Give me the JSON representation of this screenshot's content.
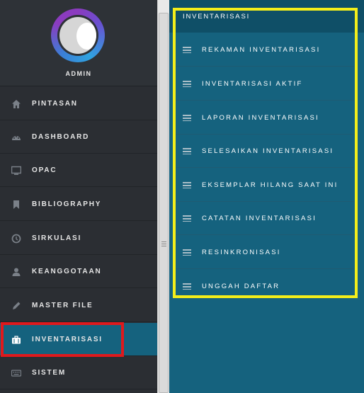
{
  "profile": {
    "name": "ADMIN"
  },
  "sidebar": {
    "items": [
      {
        "label": "PINTASAN",
        "icon": "home-icon"
      },
      {
        "label": "DASHBOARD",
        "icon": "dashboard-gauge-icon"
      },
      {
        "label": "OPAC",
        "icon": "monitor-icon"
      },
      {
        "label": "BIBLIOGRAPHY",
        "icon": "bookmark-icon"
      },
      {
        "label": "SIRKULASI",
        "icon": "clock-icon"
      },
      {
        "label": "KEANGGOTAAN",
        "icon": "user-icon"
      },
      {
        "label": "MASTER FILE",
        "icon": "pencil-icon"
      },
      {
        "label": "INVENTARISASI",
        "icon": "briefcase-icon",
        "active": true
      },
      {
        "label": "SISTEM",
        "icon": "keyboard-icon"
      }
    ]
  },
  "submenu": {
    "title": "INVENTARISASI",
    "items": [
      "REKAMAN INVENTARISASI",
      "INVENTARISASI AKTIF",
      "LAPORAN INVENTARISASI",
      "SELESAIKAN INVENTARISASI",
      "EKSEMPLAR HILANG SAAT INI",
      "CATATAN INVENTARISASI",
      "RESINKRONISASI",
      "UNGGAH DAFTAR"
    ]
  },
  "colors": {
    "sidebar_bg": "#2b2e33",
    "content_bg": "#15627e",
    "header_bg": "#0f4f67",
    "highlight_red": "#e0191c",
    "highlight_yellow": "#f4ee1a"
  }
}
